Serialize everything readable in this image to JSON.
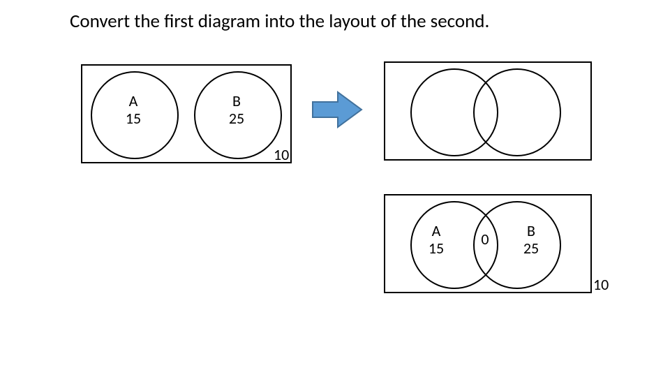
{
  "title": "Convert the first diagram into the layout of the second.",
  "chart_data": [
    {
      "type": "venn",
      "name": "source-disjoint",
      "sets": [
        {
          "label": "A",
          "only": 15,
          "intersection": null
        },
        {
          "label": "B",
          "only": 25,
          "intersection": null
        }
      ],
      "outside": 10,
      "overlap": false
    },
    {
      "type": "venn",
      "name": "target-blank-overlap",
      "sets": [
        {
          "label": "",
          "only": null,
          "intersection": null
        },
        {
          "label": "",
          "only": null,
          "intersection": null
        }
      ],
      "outside": null,
      "overlap": true
    },
    {
      "type": "venn",
      "name": "result-overlap",
      "sets": [
        {
          "label": "A",
          "only": 15,
          "intersection": 0
        },
        {
          "label": "B",
          "only": 25,
          "intersection": 0
        }
      ],
      "intersection": 0,
      "outside": 10,
      "overlap": true
    }
  ],
  "d1": {
    "a_label": "A",
    "a_val": "15",
    "b_label": "B",
    "b_val": "25",
    "outside": "10"
  },
  "d3": {
    "a_label": "A",
    "a_val": "15",
    "mid": "0",
    "b_label": "B",
    "b_val": "25",
    "outside": "10"
  }
}
